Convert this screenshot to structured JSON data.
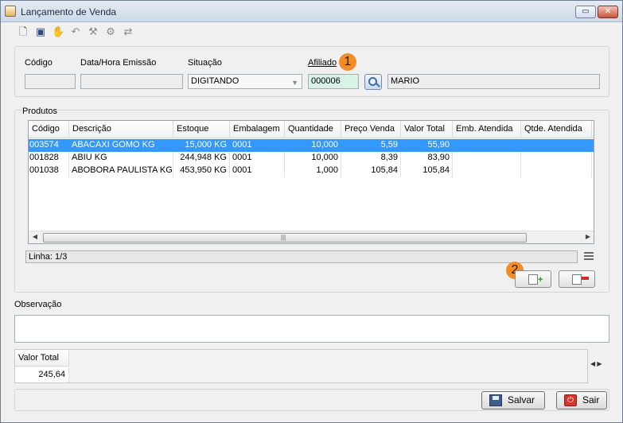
{
  "window": {
    "title": "Lançamento de Venda",
    "controls": {
      "restore": "▭",
      "close": "✕"
    }
  },
  "toolbar": {
    "icons": [
      "new-document-icon",
      "save-icon",
      "edit-icon",
      "undo-icon",
      "tool-icon",
      "settings-icon",
      "share-icon"
    ]
  },
  "header": {
    "codigo_label": "Código",
    "codigo_value": "",
    "data_label": "Data/Hora Emissão",
    "data_value": "",
    "situacao_label": "Situação",
    "situacao_value": "DIGITANDO",
    "afiliado_label": "Afiliado",
    "afiliado_code": "000006",
    "afiliado_name": "MARIO"
  },
  "badges": {
    "one": "1",
    "two": "2"
  },
  "produtos": {
    "title": "Produtos",
    "columns": [
      "Código",
      "Descrição",
      "Estoque",
      "Embalagem",
      "Quantidade",
      "Preço Venda",
      "Valor Total",
      "Emb. Atendida",
      "Qtde. Atendida"
    ],
    "rows": [
      {
        "codigo": "003574",
        "descricao": "ABACAXI GOMO KG",
        "estoque": "15,000 KG",
        "embalagem": "0001",
        "quantidade": "10,000",
        "preco": "5,59",
        "total": "55,90",
        "emb_atendida": "",
        "qtde_atendida": ""
      },
      {
        "codigo": "001828",
        "descricao": "ABIU KG",
        "estoque": "244,948 KG",
        "embalagem": "0001",
        "quantidade": "10,000",
        "preco": "8,39",
        "total": "83,90",
        "emb_atendida": "",
        "qtde_atendida": ""
      },
      {
        "codigo": "001038",
        "descricao": "ABOBORA PAULISTA KG",
        "estoque": "453,950 KG",
        "embalagem": "0001",
        "quantidade": "1,000",
        "preco": "105,84",
        "total": "105,84",
        "emb_atendida": "",
        "qtde_atendida": ""
      }
    ],
    "selected_row": 0,
    "status": "Linha: 1/3"
  },
  "observacao": {
    "label": "Observação",
    "value": ""
  },
  "totals": {
    "label": "Valor Total",
    "value": "245,64"
  },
  "footer": {
    "save_label": "Salvar",
    "exit_label": "Sair"
  },
  "colors": {
    "selection": "#3399ff",
    "badge": "#f28c28",
    "afiliado_field": "#d9f2e6"
  }
}
